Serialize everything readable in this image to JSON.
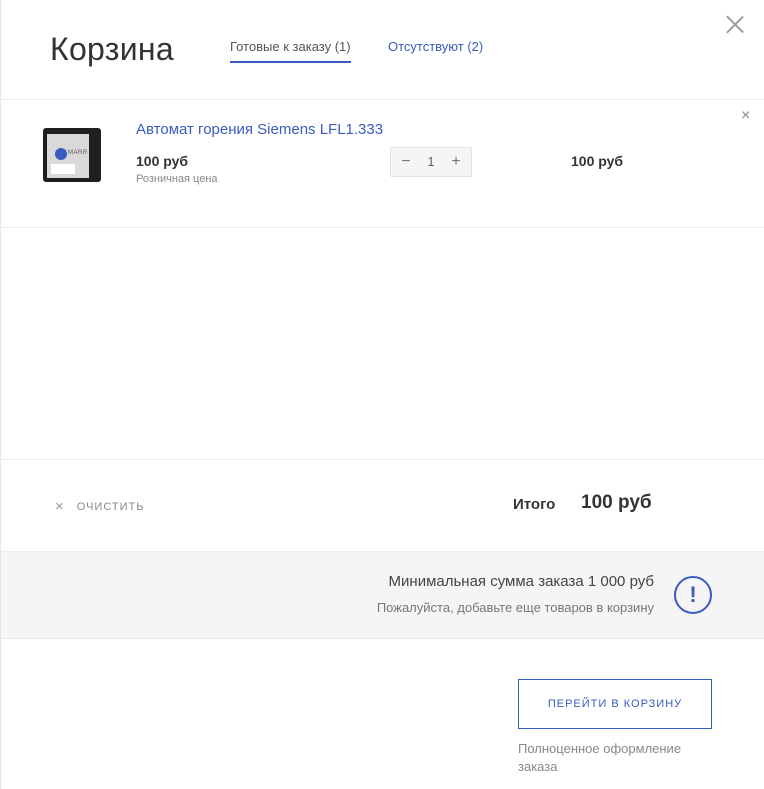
{
  "header": {
    "title": "Корзина",
    "tabs": [
      {
        "label": "Готовые к заказу (1)",
        "active": true
      },
      {
        "label": "Отсутствуют (2)",
        "active": false
      }
    ]
  },
  "close_icon": "close-icon",
  "items": [
    {
      "name": "Автомат горения Siemens LFL1.333",
      "price": "100 руб",
      "price_type": "Розничная цена",
      "quantity": "1",
      "sum": "100 руб",
      "image_brand": "MARR"
    }
  ],
  "item_remove_glyph": "×",
  "qty_minus_glyph": "−",
  "qty_plus_glyph": "+",
  "summary": {
    "clear_glyph": "×",
    "clear_label": "ОЧИСТИТЬ",
    "total_label": "Итого",
    "total_value": "100 руб"
  },
  "warning": {
    "title": "Минимальная сумма заказа 1 000 руб",
    "subtitle": "Пожалуйста, добавьте еще товаров в корзину",
    "icon_glyph": "!"
  },
  "actions": {
    "go_to_cart_label": "ПЕРЕЙТИ В КОРЗИНУ",
    "go_to_cart_note": "Полноценное оформление заказа"
  },
  "colors": {
    "accent": "#3a5bbf",
    "warning_bg": "#f5f5f5"
  }
}
